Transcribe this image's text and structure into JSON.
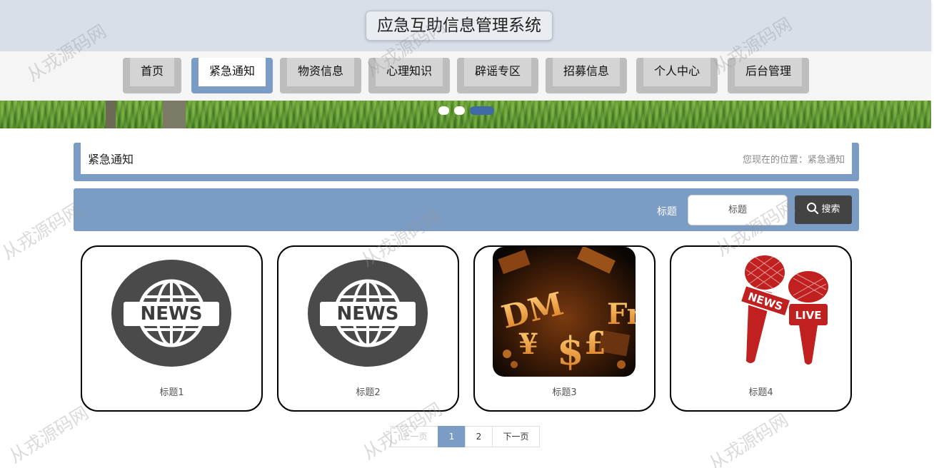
{
  "header": {
    "title": "应急互助信息管理系统"
  },
  "nav": {
    "items": [
      {
        "label": "首页",
        "active": false
      },
      {
        "label": "紧急通知",
        "active": true
      },
      {
        "label": "物资信息",
        "active": false
      },
      {
        "label": "心理知识",
        "active": false
      },
      {
        "label": "辟谣专区",
        "active": false
      },
      {
        "label": "招募信息",
        "active": false
      },
      {
        "label": "个人中心",
        "active": false
      },
      {
        "label": "后台管理",
        "active": false
      }
    ]
  },
  "banner": {
    "slide_count": 3,
    "active_slide": 3
  },
  "section": {
    "title": "紧急通知",
    "location_label": "您现在的位置：",
    "location_value": "紧急通知"
  },
  "search": {
    "label": "标题",
    "placeholder": "标题",
    "button_label": "搜索",
    "button_icon": "search-icon"
  },
  "cards": [
    {
      "caption": "标题1",
      "image": "news-globe-icon"
    },
    {
      "caption": "标题2",
      "image": "news-globe-icon"
    },
    {
      "caption": "标题3",
      "image": "currency-symbols-photo"
    },
    {
      "caption": "标题4",
      "image": "news-live-microphones-icon"
    }
  ],
  "pagination": {
    "prev_label": "上一页",
    "pages": [
      "1",
      "2"
    ],
    "current_page": "1",
    "next_label": "下一页"
  },
  "watermark_text": "从戎源码网",
  "colors": {
    "accent": "#7b9cc4",
    "header_bg": "#d8dfe9",
    "search_button": "#434343",
    "news_circle": "#4a4a4a",
    "live_red": "#c0201f"
  }
}
